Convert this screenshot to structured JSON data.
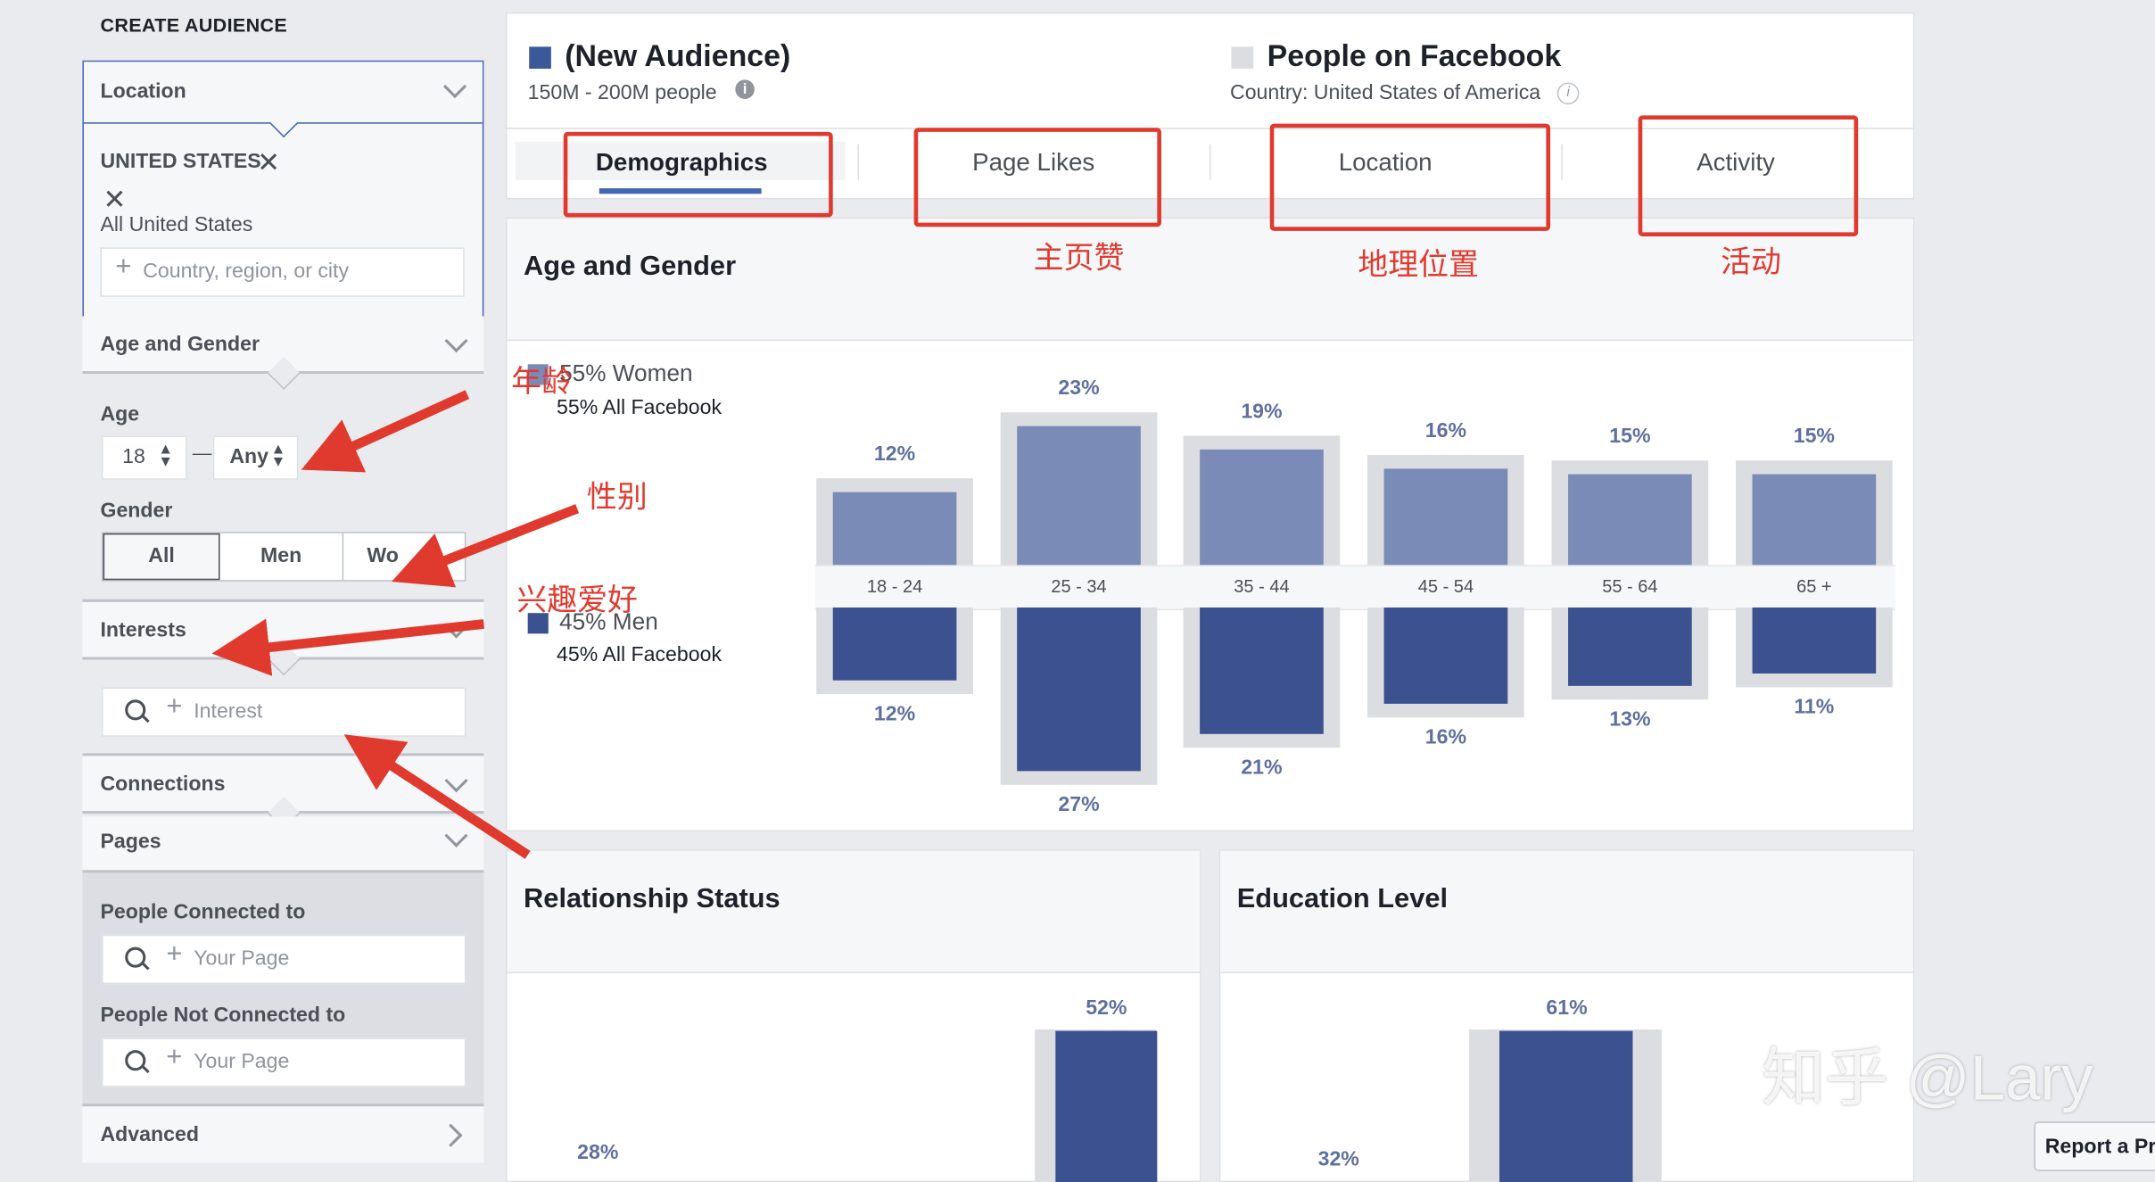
{
  "sidebar": {
    "title": "CREATE AUDIENCE",
    "location": {
      "header": "Location",
      "selected": "UNITED STATES",
      "selected_sub": "All United States",
      "placeholder": "Country, region, or city"
    },
    "age_gender": {
      "header": "Age and Gender",
      "age_label": "Age",
      "age_min": "18",
      "age_sep": "—",
      "age_max": "Any",
      "gender_label": "Gender",
      "gender_options": [
        "All",
        "Men",
        "Wo"
      ]
    },
    "interests": {
      "header": "Interests",
      "placeholder": "Interest"
    },
    "connections": {
      "header": "Connections"
    },
    "pages": {
      "header": "Pages",
      "connected_label": "People Connected to",
      "connected_placeholder": "Your Page",
      "not_connected_label": "People Not Connected to",
      "not_connected_placeholder": "Your Page"
    },
    "advanced": {
      "header": "Advanced"
    }
  },
  "header": {
    "audience_name": "(New Audience)",
    "audience_size": "150M - 200M people",
    "compare_name": "People on Facebook",
    "compare_sub": "Country: United States of America",
    "audience_color": "#3b5998",
    "compare_color": "#dcdde1"
  },
  "tabs": [
    "Demographics",
    "Page Likes",
    "Location",
    "Activity"
  ],
  "annotations": {
    "page_likes_cn": "主页赞",
    "location_cn": "地理位置",
    "activity_cn": "活动",
    "age_cn": "年龄",
    "gender_cn": "性别",
    "interests_cn": "兴趣爱好",
    "annotation_color": "#e03a2f"
  },
  "age_gender_section": {
    "title": "Age and Gender",
    "women_legend": "55% Women",
    "women_sub": "55% All Facebook",
    "men_legend": "45% Men",
    "men_sub": "45% All Facebook"
  },
  "chart_data": {
    "type": "bar",
    "categories": [
      "18 - 24",
      "25 - 34",
      "35 - 44",
      "45 - 54",
      "55 - 64",
      "65 +"
    ],
    "series": [
      {
        "name": "Women",
        "values": [
          12,
          23,
          19,
          16,
          15,
          15
        ],
        "labels": [
          "12%",
          "23%",
          "19%",
          "16%",
          "15%",
          "15%"
        ],
        "color": "#7b8bb8"
      },
      {
        "name": "Men",
        "values": [
          12,
          27,
          21,
          16,
          13,
          11
        ],
        "labels": [
          "12%",
          "27%",
          "21%",
          "16%",
          "13%",
          "11%"
        ],
        "color": "#3b5190"
      }
    ],
    "ylim": [
      0,
      27
    ]
  },
  "relationship": {
    "title": "Relationship Status",
    "values": [
      "52%",
      "28%"
    ]
  },
  "education": {
    "title": "Education Level",
    "values": [
      "61%",
      "32%"
    ]
  },
  "watermark": "知乎 @Lary",
  "report_button": "Report a Pr"
}
